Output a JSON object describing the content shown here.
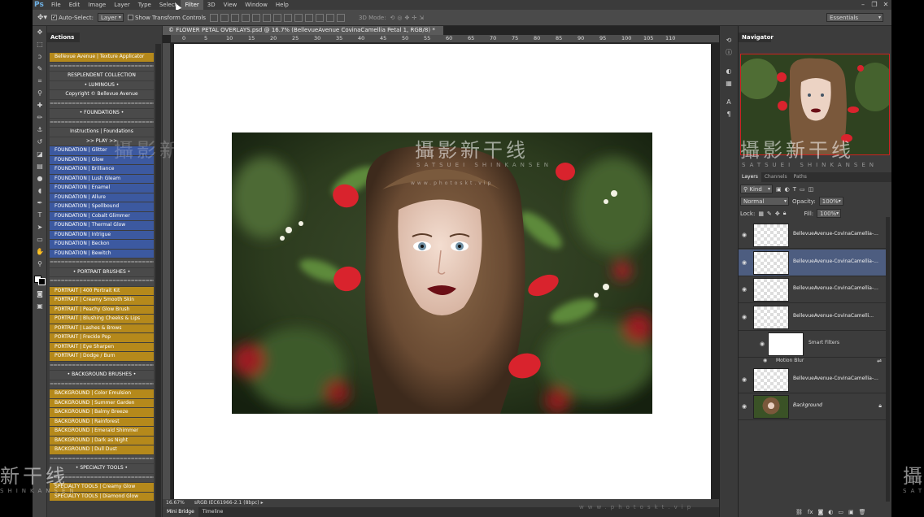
{
  "app": {
    "logo": "Ps"
  },
  "menubar": {
    "items": [
      "File",
      "Edit",
      "Image",
      "Layer",
      "Type",
      "Select",
      "Filter",
      "3D",
      "View",
      "Window",
      "Help"
    ],
    "active": "Filter"
  },
  "window_controls": [
    "–",
    "❐",
    "✕"
  ],
  "options_bar": {
    "auto_select_label": "Auto-Select:",
    "auto_select_value": "Layer",
    "show_transform_label": "Show Transform Controls",
    "mode_3d_label": "3D Mode:",
    "workspace": "Essentials"
  },
  "actions_panel": {
    "tab": "Actions",
    "items": [
      {
        "text": "Bellevue Avenue | Texture Applicator",
        "style": "gold"
      },
      {
        "text": "=============================",
        "style": "sep"
      },
      {
        "text": "RESPLENDENT COLLECTION",
        "style": "dark"
      },
      {
        "text": "•  LUMINOUS  •",
        "style": "dark"
      },
      {
        "text": "Copyright © Bellevue Avenue",
        "style": "dark"
      },
      {
        "text": "=============================",
        "style": "sep"
      },
      {
        "text": "•  FOUNDATIONS  •",
        "style": "dark"
      },
      {
        "text": "=============================",
        "style": "sep"
      },
      {
        "text": "Instructions | Foundations",
        "style": "dark"
      },
      {
        "text": ">> PLAY >>",
        "style": "dark"
      },
      {
        "text": "FOUNDATION | Glitter",
        "style": "blue"
      },
      {
        "text": "FOUNDATION | Glow",
        "style": "blue"
      },
      {
        "text": "FOUNDATION | Brilliance",
        "style": "blue"
      },
      {
        "text": "FOUNDATION | Lush Gleam",
        "style": "blue"
      },
      {
        "text": "FOUNDATION | Enamel",
        "style": "blue"
      },
      {
        "text": "FOUNDATION | Allure",
        "style": "blue"
      },
      {
        "text": "FOUNDATION | Spellbound",
        "style": "blue"
      },
      {
        "text": "FOUNDATION | Cobalt Glimmer",
        "style": "blue"
      },
      {
        "text": "FOUNDATION | Thermal Glow",
        "style": "blue"
      },
      {
        "text": "FOUNDATION | Intrigue",
        "style": "blue"
      },
      {
        "text": "FOUNDATION | Beckon",
        "style": "blue"
      },
      {
        "text": "FOUNDATION | Bewitch",
        "style": "blue"
      },
      {
        "text": "=============================",
        "style": "sep"
      },
      {
        "text": "•  PORTRAIT BRUSHES  •",
        "style": "dark"
      },
      {
        "text": "=============================",
        "style": "sep"
      },
      {
        "text": "PORTRAIT | 400 Portrait Kit",
        "style": "gold"
      },
      {
        "text": "PORTRAIT | Creamy Smooth Skin",
        "style": "gold"
      },
      {
        "text": "PORTRAIT | Peachy Glow Brush",
        "style": "gold"
      },
      {
        "text": "PORTRAIT | Blushing Cheeks & Lips",
        "style": "gold"
      },
      {
        "text": "PORTRAIT | Lashes & Brows",
        "style": "gold"
      },
      {
        "text": "PORTRAIT | Freckle Pop",
        "style": "gold"
      },
      {
        "text": "PORTRAIT | Eye Sharpen",
        "style": "gold"
      },
      {
        "text": "PORTRAIT | Dodge / Burn",
        "style": "gold"
      },
      {
        "text": "=============================",
        "style": "sep"
      },
      {
        "text": "•  BACKGROUND BRUSHES  •",
        "style": "dark"
      },
      {
        "text": "=============================",
        "style": "sep"
      },
      {
        "text": "BACKGROUND | Color Emulsion",
        "style": "gold"
      },
      {
        "text": "BACKGROUND | Summer Garden",
        "style": "gold"
      },
      {
        "text": "BACKGROUND | Balmy Breeze",
        "style": "gold"
      },
      {
        "text": "BACKGROUND | Rainforest",
        "style": "gold"
      },
      {
        "text": "BACKGROUND | Emerald Shimmer",
        "style": "gold"
      },
      {
        "text": "BACKGROUND | Dark as Night",
        "style": "gold"
      },
      {
        "text": "BACKGROUND | Dull Dust",
        "style": "gold"
      },
      {
        "text": "=============================",
        "style": "sep"
      },
      {
        "text": "•  SPECIALTY TOOLS  •",
        "style": "dark"
      },
      {
        "text": "=============================",
        "style": "sep"
      },
      {
        "text": "SPECIALTY TOOLS | Creamy Glow",
        "style": "gold"
      },
      {
        "text": "SPECIALTY TOOLS | Diamond Glow",
        "style": "gold"
      }
    ]
  },
  "document": {
    "tab_title": "© FLOWER PETAL OVERLAYS.psd @ 16.7% (BellevueAvenue CovinaCamellia Petal 1, RGB/8) *",
    "tab_close": "×",
    "ruler_labels": [
      "0",
      "5",
      "10",
      "15",
      "20",
      "25",
      "30",
      "35",
      "40",
      "45",
      "50",
      "55",
      "60",
      "65",
      "70",
      "75",
      "80",
      "85",
      "90",
      "95",
      "100",
      "105",
      "110"
    ],
    "zoom": "16.67%",
    "color_profile": "sRGB IEC61966-2.1 (8bpc)"
  },
  "bottom_tabs": [
    "Mini Bridge",
    "Timeline"
  ],
  "navigator": {
    "tab": "Navigator"
  },
  "layers_panel": {
    "tabs": [
      "Layers",
      "Channels",
      "Paths"
    ],
    "filter_kind": "Kind",
    "blend_mode": "Normal",
    "opacity_label": "Opacity:",
    "opacity_value": "100%",
    "lock_label": "Lock:",
    "fill_label": "Fill:",
    "fill_value": "100%",
    "layers": [
      {
        "name": "BellevueAvenue-CovinaCamellia-...",
        "selected": false
      },
      {
        "name": "BellevueAvenue-CovinaCamellia-...",
        "selected": true
      },
      {
        "name": "BellevueAvenue-CovinaCamellia-...",
        "selected": false
      },
      {
        "name": "BellevueAvenue-CovinaCamelli...",
        "selected": false
      }
    ],
    "smart_filters_label": "Smart Filters",
    "motion_blur_label": "Motion Blur",
    "layer5_name": "BellevueAvenue-CovinaCamellia-...",
    "background_name": "Background"
  },
  "watermark": {
    "chinese": "攝影新干线",
    "latin": "SATSUEI SHINKANSEN",
    "url": "www.photoskt.vip",
    "edge_left": "新干线",
    "edge_left_latin": "SHINKANSEN",
    "edge_right": "攝",
    "edge_right_latin": "SAT"
  },
  "colors": {
    "gold": "#b5891b",
    "blue": "#3c59a0",
    "accent": "#6fb2e6",
    "selection": "#4d5d80"
  }
}
